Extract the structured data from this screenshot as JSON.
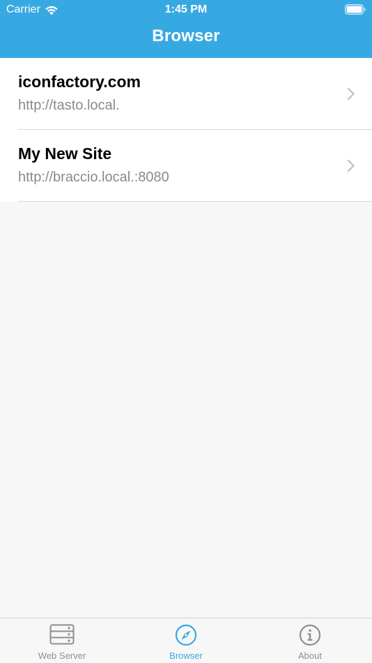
{
  "status_bar": {
    "carrier": "Carrier",
    "time": "1:45 PM"
  },
  "nav": {
    "title": "Browser"
  },
  "sites": [
    {
      "name": "iconfactory.com",
      "url": "http://tasto.local."
    },
    {
      "name": "My New Site",
      "url": "http://braccio.local.:8080"
    }
  ],
  "tabs": [
    {
      "label": "Web Server",
      "icon": "server-icon",
      "active": false
    },
    {
      "label": "Browser",
      "icon": "compass-icon",
      "active": true
    },
    {
      "label": "About",
      "icon": "info-icon",
      "active": false
    }
  ],
  "colors": {
    "accent": "#37a9e2",
    "background": "#f7f7f7",
    "secondary_text": "#8a8a8e",
    "inactive_tab": "#8e8e93"
  }
}
